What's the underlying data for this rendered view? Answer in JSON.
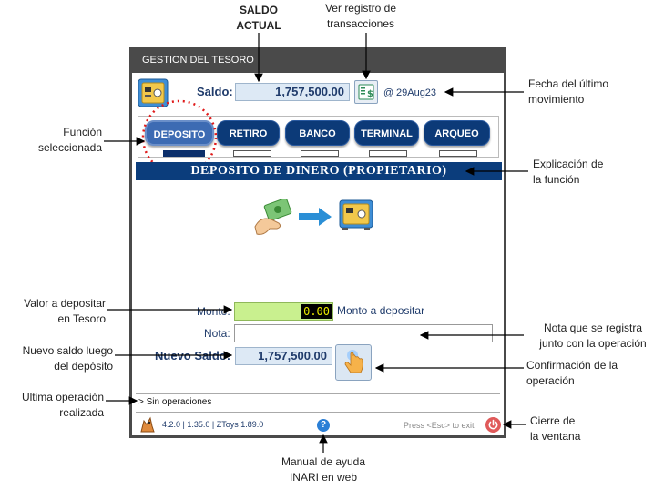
{
  "callouts": {
    "saldo_actual": [
      "SALDO",
      "ACTUAL"
    ],
    "ver_registro": [
      "Ver registro de",
      "transacciones"
    ],
    "fecha_ultimo": [
      "Fecha del último",
      "movimiento"
    ],
    "funcion_seleccionada": [
      "Función",
      "seleccionada"
    ],
    "explicacion_funcion": [
      "Explicación de",
      "la función"
    ],
    "valor_depositar": [
      "Valor a depositar",
      "en Tesoro"
    ],
    "nota_registra": [
      "Nota que se registra",
      "junto con la operación"
    ],
    "nuevo_saldo_luego": [
      "Nuevo saldo luego",
      "del depósito"
    ],
    "confirmacion": [
      "Confirmación de la",
      "operación"
    ],
    "ultima_operacion": [
      "Ultima operación",
      "realizada"
    ],
    "cierre_ventana": [
      "Cierre de",
      "la ventana"
    ],
    "manual_ayuda": [
      "Manual de ayuda",
      "INARI en web"
    ]
  },
  "window": {
    "title": "GESTION DEL TESORO",
    "saldo_label": "Saldo:",
    "saldo_value": "1,757,500.00",
    "date_prefix": "@",
    "date_value": "29Aug23",
    "tabs": [
      {
        "label": "DEPOSITO",
        "active": true
      },
      {
        "label": "RETIRO",
        "active": false
      },
      {
        "label": "BANCO",
        "active": false
      },
      {
        "label": "TERMINAL",
        "active": false
      },
      {
        "label": "ARQUEO",
        "active": false
      }
    ],
    "banner": "DEPOSITO DE DINERO (PROPIETARIO)",
    "monto_label": "Monto:",
    "monto_value": "0.00",
    "monto_hint": "Monto a depositar",
    "nota_label": "Nota:",
    "nota_value": "",
    "nuevo_saldo_label": "Nuevo Saldo:",
    "nuevo_saldo_value": "1,757,500.00",
    "last_op": "> Sin operaciones",
    "version": "4.2.0 | 1.35.0 | ZToys 1.89.0",
    "exit_hint": "Press <Esc> to exit",
    "help_glyph": "?"
  },
  "colors": {
    "accent": "#0b3d7c",
    "tab_active": "#3d6bb3",
    "monto_bg": "#c9f08f",
    "field_bg": "#dde9f5",
    "close_red": "#e05a5a"
  }
}
